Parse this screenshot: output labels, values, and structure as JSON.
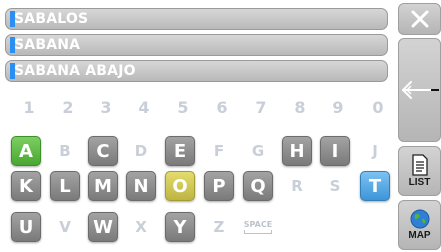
{
  "suggestions": [
    "SABALOS",
    "SABANA",
    "SABANA ABAJO"
  ],
  "digits": [
    "1",
    "2",
    "3",
    "4",
    "5",
    "6",
    "7",
    "8",
    "9",
    "0"
  ],
  "keyboard": {
    "row1": [
      {
        "label": "A",
        "state": "green"
      },
      {
        "label": "B",
        "state": "inactive"
      },
      {
        "label": "C",
        "state": "active"
      },
      {
        "label": "D",
        "state": "inactive"
      },
      {
        "label": "E",
        "state": "active"
      },
      {
        "label": "F",
        "state": "inactive"
      },
      {
        "label": "G",
        "state": "inactive"
      },
      {
        "label": "H",
        "state": "active"
      },
      {
        "label": "I",
        "state": "active"
      },
      {
        "label": "J",
        "state": "inactive"
      }
    ],
    "row2": [
      {
        "label": "K",
        "state": "active"
      },
      {
        "label": "L",
        "state": "active"
      },
      {
        "label": "M",
        "state": "active"
      },
      {
        "label": "N",
        "state": "active"
      },
      {
        "label": "O",
        "state": "yellow"
      },
      {
        "label": "P",
        "state": "active"
      },
      {
        "label": "Q",
        "state": "active"
      },
      {
        "label": "R",
        "state": "inactive"
      },
      {
        "label": "S",
        "state": "inactive"
      },
      {
        "label": "T",
        "state": "blue"
      }
    ],
    "row3": [
      {
        "label": "U",
        "state": "active"
      },
      {
        "label": "V",
        "state": "inactive"
      },
      {
        "label": "W",
        "state": "active"
      },
      {
        "label": "X",
        "state": "inactive"
      },
      {
        "label": "Y",
        "state": "active"
      },
      {
        "label": "Z",
        "state": "inactive"
      },
      {
        "label": "SPACE",
        "state": "space"
      }
    ]
  },
  "sidebar": {
    "list_label": "LIST",
    "map_label": "MAP"
  },
  "colors": {
    "highlight": "#2a8ff0",
    "green_key": "#4aa631",
    "yellow_key": "#bdb443",
    "blue_key": "#3d95d8",
    "disabled_text": "#c9cfd8"
  },
  "icons": {
    "close": "close-icon",
    "back": "backspace-arrow-icon",
    "list": "list-document-icon",
    "map": "globe-map-icon"
  }
}
